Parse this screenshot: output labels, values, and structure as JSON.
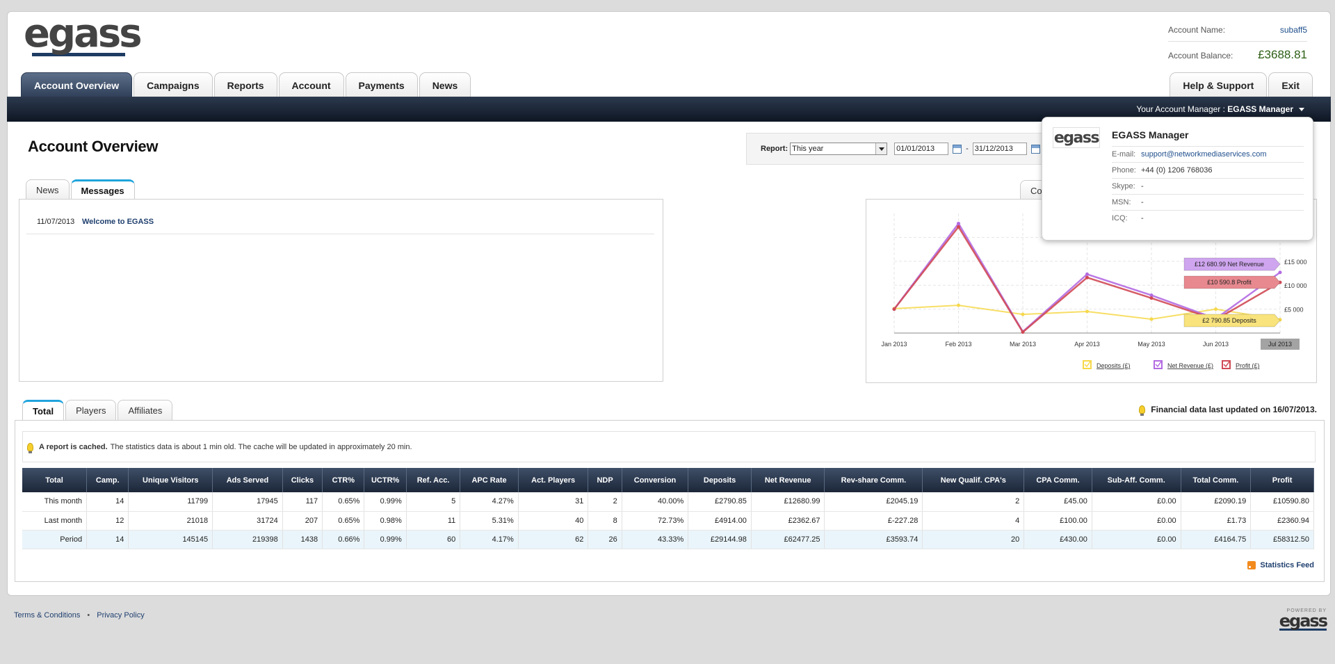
{
  "logo": {
    "text": "egass"
  },
  "account": {
    "name_label": "Account Name:",
    "name_value": "subaff5",
    "balance_label": "Account Balance:",
    "balance_value": "£3688.81"
  },
  "nav": {
    "tabs": [
      "Account Overview",
      "Campaigns",
      "Reports",
      "Account",
      "Payments",
      "News"
    ],
    "right_tabs": [
      "Help & Support",
      "Exit"
    ],
    "manager_label": "Your Account Manager : ",
    "manager_name": "EGASS Manager"
  },
  "page_title": "Account Overview",
  "report": {
    "label": "Report:",
    "selected": "This year",
    "from": "01/01/2013",
    "to": "31/12/2013",
    "dash": "-"
  },
  "news_tabs": [
    "News",
    "Messages"
  ],
  "messages": [
    {
      "date": "11/07/2013",
      "title": "Welcome to EGASS"
    }
  ],
  "chart_tab_label": "Co",
  "popup": {
    "logo": "egass",
    "name": "EGASS Manager",
    "rows": [
      {
        "label": "E-mail:",
        "value": "support@networkmediaservices.com"
      },
      {
        "label": "Phone:",
        "value": "+44 (0) 1206 768036"
      },
      {
        "label": "Skype:",
        "value": "-"
      },
      {
        "label": "MSN:",
        "value": "-"
      },
      {
        "label": "ICQ:",
        "value": "-"
      }
    ]
  },
  "chart_data": {
    "type": "line",
    "categories": [
      "Jan 2013",
      "Feb 2013",
      "Mar 2013",
      "Apr 2013",
      "May 2013",
      "Jun 2013",
      "Jul 2013"
    ],
    "y_ticks": [
      "£5 000",
      "£10 000",
      "£15 000"
    ],
    "ylim": [
      0,
      25000
    ],
    "series": [
      {
        "name": "Deposits (£)",
        "color": "#f6d84a",
        "values": [
          5100,
          5800,
          3900,
          4500,
          2900,
          5000,
          2790.85
        ]
      },
      {
        "name": "Net Revenue (£)",
        "color": "#b36ae2",
        "values": [
          5000,
          22900,
          300,
          12300,
          7900,
          3000,
          12680.99
        ]
      },
      {
        "name": "Profit (£)",
        "color": "#d04a55",
        "values": [
          5000,
          22200,
          200,
          11600,
          7300,
          2800,
          10590.8
        ]
      }
    ],
    "annotations": {
      "net_revenue": "£12 680.99 Net Revenue",
      "profit": "£10 590.8 Profit",
      "deposits": "£2 790.85 Deposits",
      "highlight_label": "Jul 2013"
    },
    "legend": [
      "Deposits (£)",
      "Net Revenue (£)",
      "Profit (£)"
    ],
    "legend_position": "bottom"
  },
  "stats": {
    "tabs": [
      "Total",
      "Players",
      "Affiliates"
    ],
    "financial_updated": "Financial data last updated on 16/07/2013.",
    "cached_bold": "A report is cached.",
    "cached_text": "The statistics data is about 1 min old. The cache will be updated in approximately 20 min.",
    "columns": [
      "Total",
      "Camp.",
      "Unique Visitors",
      "Ads Served",
      "Clicks",
      "CTR%",
      "UCTR%",
      "Ref. Acc.",
      "APC Rate",
      "Act. Players",
      "NDP",
      "Conversion",
      "Deposits",
      "Net Revenue",
      "Rev-share Comm.",
      "New Qualif. CPA's",
      "CPA Comm.",
      "Sub-Aff. Comm.",
      "Total Comm.",
      "Profit"
    ],
    "rows": [
      [
        "This month",
        "14",
        "11799",
        "17945",
        "117",
        "0.65%",
        "0.99%",
        "5",
        "4.27%",
        "31",
        "2",
        "40.00%",
        "£2790.85",
        "£12680.99",
        "£2045.19",
        "2",
        "£45.00",
        "£0.00",
        "£2090.19",
        "£10590.80"
      ],
      [
        "Last month",
        "12",
        "21018",
        "31724",
        "207",
        "0.65%",
        "0.98%",
        "11",
        "5.31%",
        "40",
        "8",
        "72.73%",
        "£4914.00",
        "£2362.67",
        "£-227.28",
        "4",
        "£100.00",
        "£0.00",
        "£1.73",
        "£2360.94"
      ],
      [
        "Period",
        "14",
        "145145",
        "219398",
        "1438",
        "0.66%",
        "0.99%",
        "60",
        "4.17%",
        "62",
        "26",
        "43.33%",
        "£29144.98",
        "£62477.25",
        "£3593.74",
        "20",
        "£430.00",
        "£0.00",
        "£4164.75",
        "£58312.50"
      ]
    ],
    "feed": "Statistics Feed"
  },
  "footer": {
    "terms": "Terms & Conditions",
    "dot": "•",
    "privacy": "Privacy Policy",
    "powered_by": "POWERED BY",
    "powered_logo": "egass"
  }
}
